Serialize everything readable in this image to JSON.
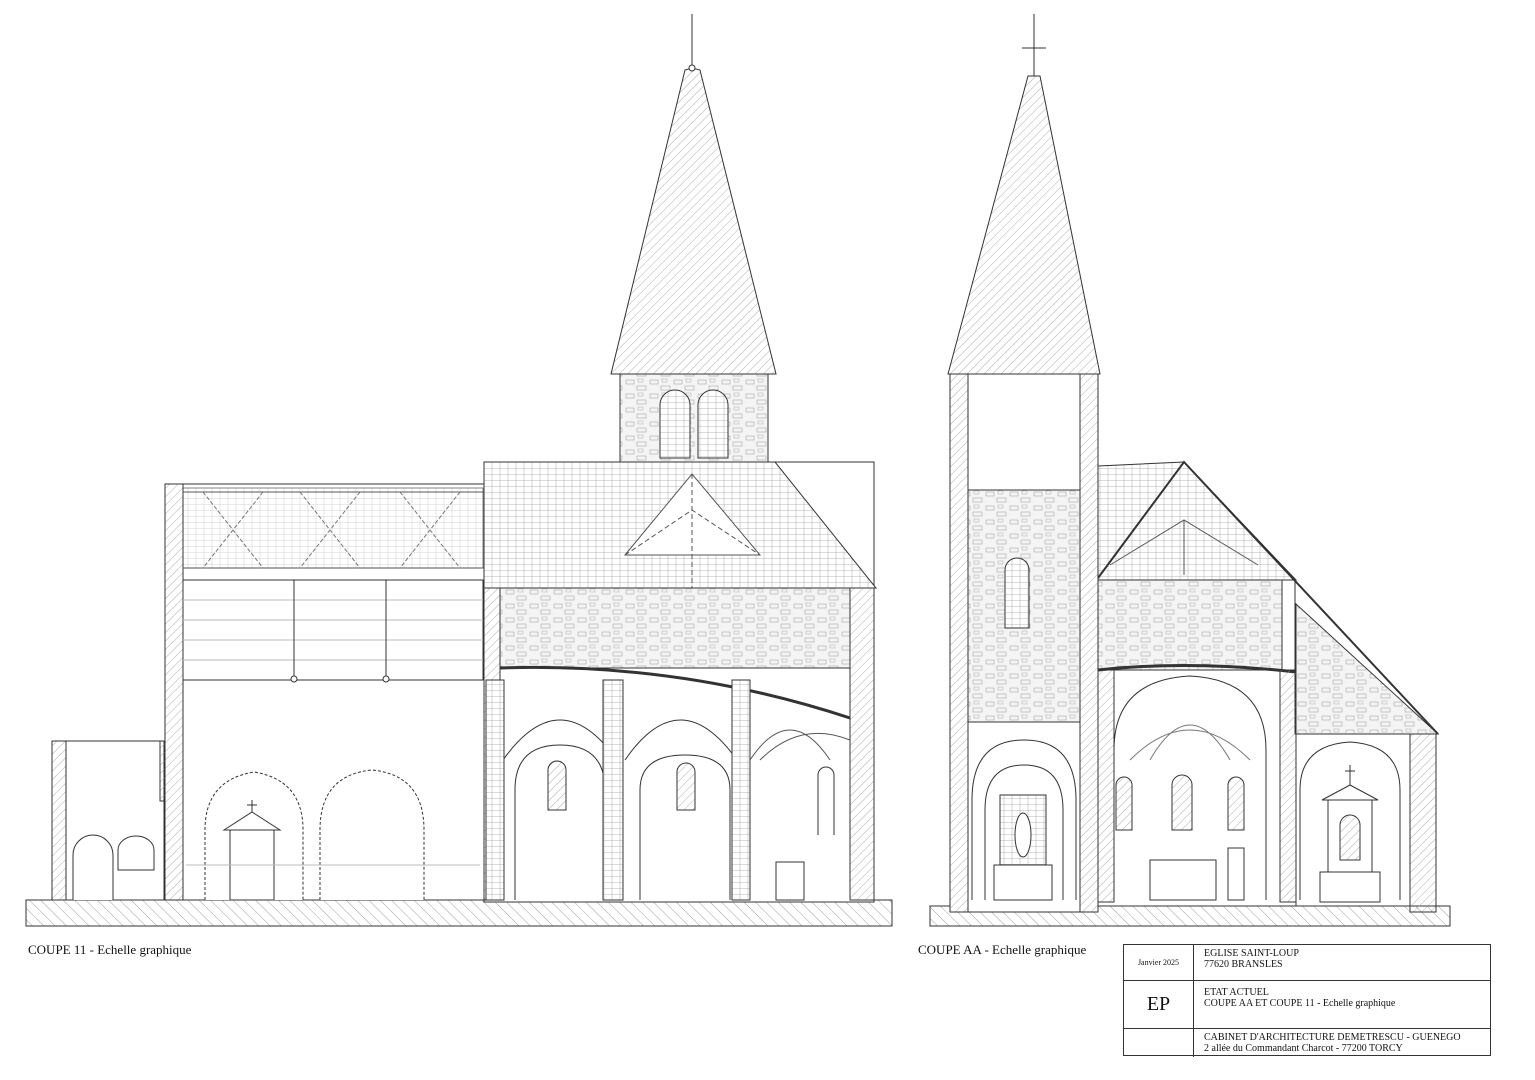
{
  "captions": {
    "left": "COUPE 11 - Echelle graphique",
    "right": "COUPE AA - Echelle graphique"
  },
  "cartouche": {
    "date": "Janvier 2025",
    "project_name": "EGLISE SAINT-LOUP",
    "project_location": "77620 BRANSLES",
    "initials": "EP",
    "sheet_status": "ETAT ACTUEL",
    "sheet_title": "COUPE AA ET COUPE 11 - Echelle graphique",
    "office_name": "CABINET D'ARCHITECTURE DEMETRESCU - GUENEGO",
    "office_address": "2 allée du Commandant Charcot - 77200 TORCY"
  },
  "colors": {
    "line": "#333333",
    "hatch": "#9a9a9a",
    "paper": "#ffffff"
  }
}
